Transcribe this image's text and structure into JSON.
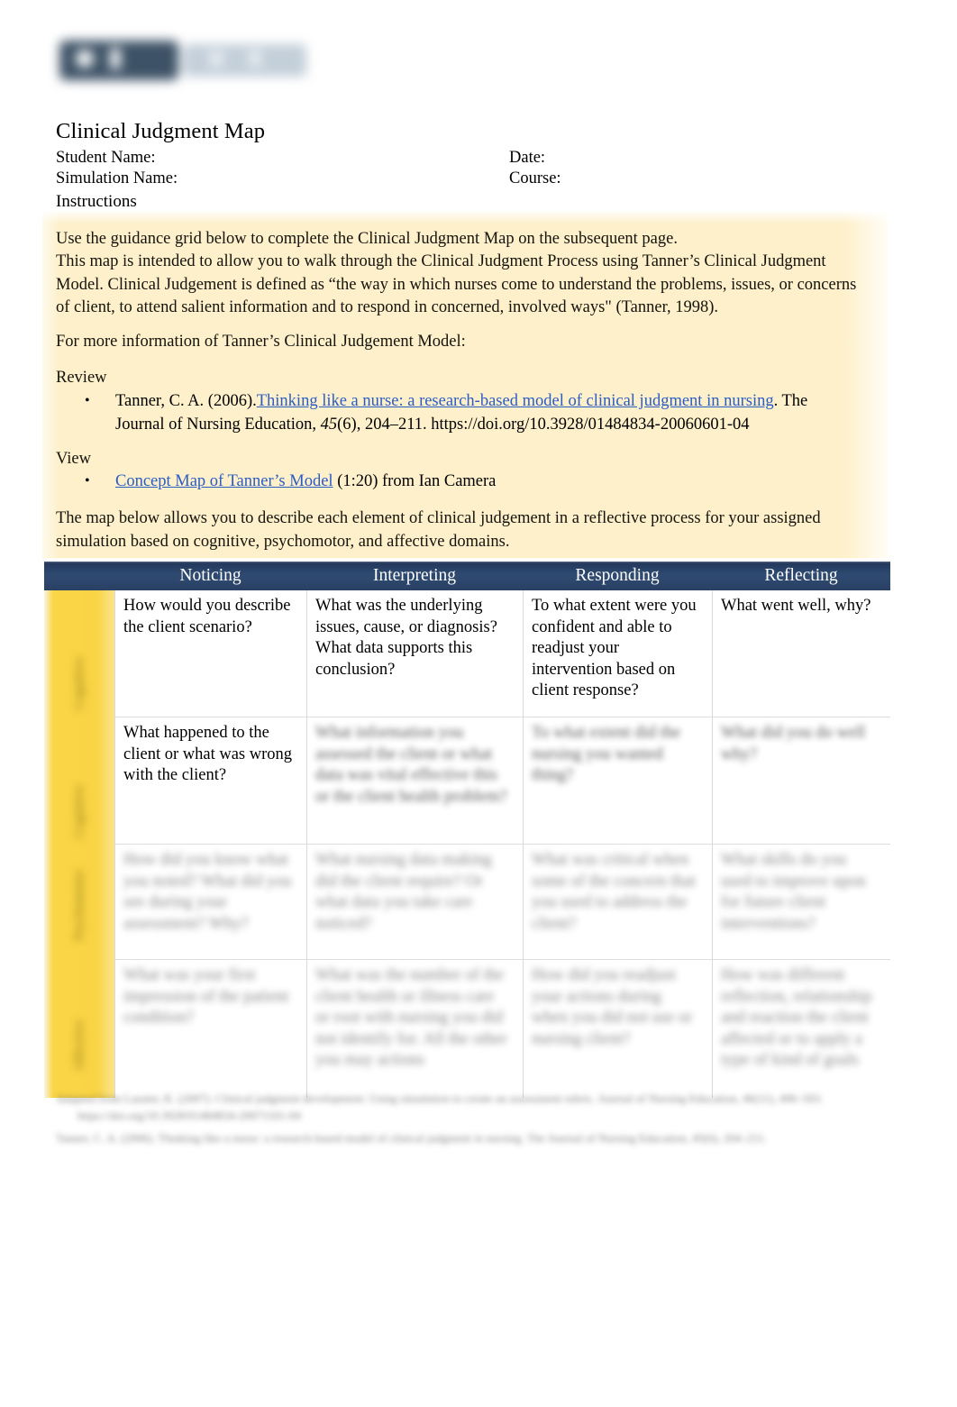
{
  "document": {
    "title": "Clinical Judgment Map",
    "logo_alt": "institution-logo-redacted"
  },
  "header_fields": {
    "student_name_label": "Student Name:",
    "date_label": "Date:",
    "simulation_name_label": "Simulation Name:",
    "course_label": "Course:"
  },
  "instructions": {
    "heading": "Instructions",
    "paragraph_1": "Use the guidance grid below to complete the  Clinical Judgment Map on the subsequent page.",
    "paragraph_2": "This map is intended to allow you to walk through the Clinical Judgment Process using Tanner’s Clinical Judgment Model. Clinical Judgement is defined as “the way in which nurses come to understand the problems, issues, or concerns of client, to attend salient information and to respond in concerned, involved ways\" (Tanner, 1998).",
    "paragraph_3": "For more information of Tanner’s Clinical Judgement Model:",
    "review_label": "Review",
    "view_label": "View",
    "paragraph_4": "The map below allows you to describe each element of clinical judgement in a reflective process for your assigned simulation based on cognitive, psychomotor, and affective domains."
  },
  "references": {
    "tanner_citation": {
      "prefix": "Tanner, C. A. (2006).",
      "link_text": "Thinking like a nurse: a research-based model of clinical judgment in nursing",
      "suffix": ". The Journal of Nursing Education, ",
      "volume": "45",
      "issue_pages": "(6), 204–211. https://doi.org/10.3928/01484834-20060601-04"
    },
    "concept_map": {
      "link_text": "Concept Map of Tanner’s Model",
      "suffix": " (1:20) from Ian Camera"
    },
    "bullet_glyph": "•"
  },
  "table": {
    "columns": [
      "",
      "Noticing",
      "Interpreting",
      "Responding",
      "Reflecting"
    ],
    "row_side_labels": [
      "Cognitive",
      "Cognitive",
      "Psychomotor",
      "Affective"
    ],
    "rows": [
      {
        "blurred": false,
        "cells": [
          "How would you describe the client scenario?",
          "What was the underlying issues, cause, or diagnosis? What data supports this conclusion?",
          "To what extent were you confident and able to readjust your intervention based on client response?",
          "What went well, why?"
        ]
      },
      {
        "blurred": false,
        "first_cell_clear": true,
        "cells": [
          "What happened to the client or what was wrong with the client?",
          "What information you assessed the client or what data was vital effective this or the client health problem?",
          "To what extent did the nursing you wanted thing?",
          "What did you do well why?"
        ]
      },
      {
        "blurred": true,
        "cells": [
          "How did you know what you noted? What did you see during your assessment? Why?",
          "What nursing data making did the client require? Or what data you take care noticed?",
          "What was critical when some of the concern that you used to address the client?",
          "What skills do you used to improve upon for future client interventions?"
        ]
      },
      {
        "blurred": true,
        "cells": [
          "What was your first impression of the patient condition?",
          "What was the number of the client health or illness care or root with nursing you did not identify for. All the other you may actions",
          "How did you readjust your actions during when you did not use or nursing client?",
          "How was different reflection, relationship and reaction the client affected or to apply a type of kind of goals"
        ]
      }
    ]
  },
  "footnotes": {
    "line_1": "Adapted from Lasater, K. (2007). Clinical judgment development: Using simulation to create an assessment rubric. Journal of Nursing Education, 46(11), 496–503. https://doi.org/10.3928/01484834-20071101-04",
    "line_2": "Tanner, C. A. (2006). Thinking like a nurse: a research-based model of clinical judgment in nursing. The Journal of Nursing Education, 45(6), 204–211."
  },
  "colors": {
    "header_navy": "#2f4a71",
    "side_band_gold": "#fad646",
    "instruction_cream": "#fdf0cb",
    "link_blue": "#2b5cc4"
  }
}
